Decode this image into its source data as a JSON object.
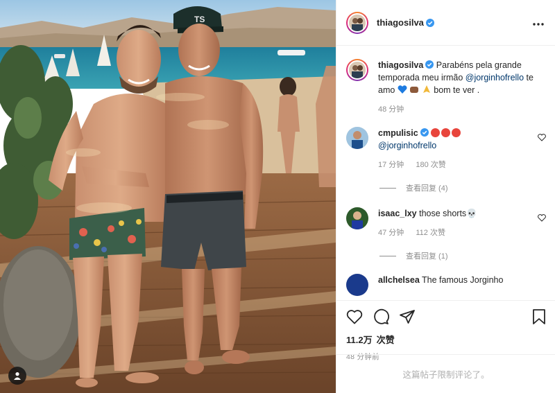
{
  "post": {
    "author": "thiagosilva",
    "verified": true,
    "more_icon": "more-horizontal-icon"
  },
  "caption": {
    "author": "thiagosilva",
    "text": "Parabéns pela grande temporada meu irmão",
    "mention": "@jorginhofrello",
    "text_after": "te amo",
    "text_end": "bom te ver .",
    "time": "48 分钟"
  },
  "comments": [
    {
      "user": "cmpulisic",
      "verified": true,
      "text": "",
      "mention": "@jorginhofrello",
      "time": "17 分钟",
      "likes": "180 次赞",
      "replies": "查看回复 (4)"
    },
    {
      "user": "isaac_lxy",
      "verified": false,
      "text": "those shorts💀",
      "time": "47 分钟",
      "likes": "112 次赞",
      "replies": "查看回复 (1)"
    },
    {
      "user": "allchelsea",
      "text": "The famous Jorginho"
    }
  ],
  "actions": {
    "like_icon": "heart-icon",
    "comment_icon": "comment-icon",
    "share_icon": "share-icon",
    "save_icon": "bookmark-icon",
    "likes_count": "11.2万",
    "likes_label": "次赞",
    "posted_time": "48 分钟前"
  },
  "comments_disabled": "这篇帖子限制评论了。",
  "photo": {
    "tag_icon": "user-tag-icon"
  },
  "colors": {
    "link": "#00376b",
    "muted": "#8e8e8e",
    "verified": "#3897f0",
    "border": "#efefef"
  }
}
